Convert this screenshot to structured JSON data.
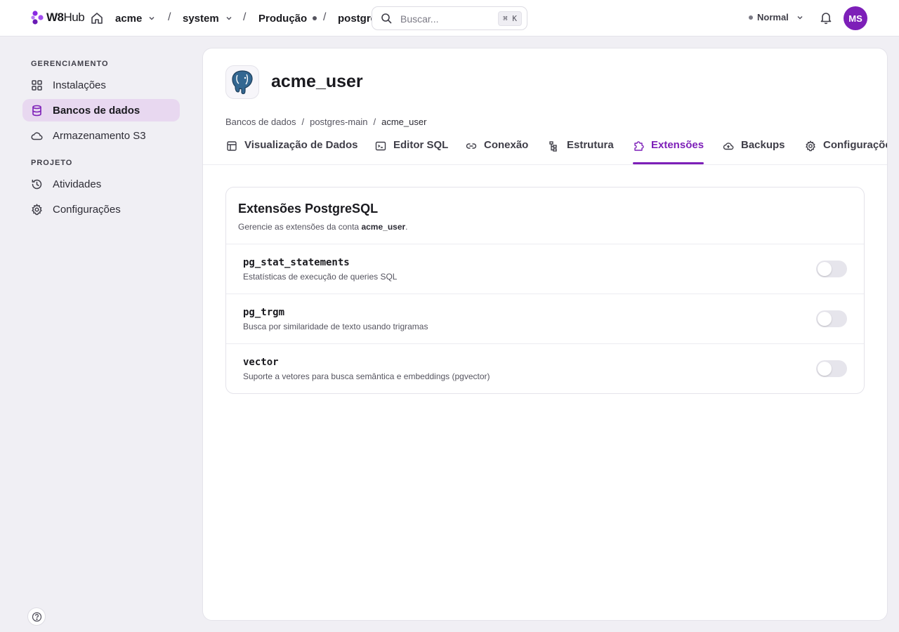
{
  "topbar": {
    "logo_bold": "W8",
    "logo_light": "Hub",
    "crumbs": [
      "acme",
      "system",
      "Produção",
      "postgres"
    ],
    "separator": "/",
    "search_placeholder": "Buscar...",
    "search_shortcut": "⌘ K",
    "mode_label": "Normal",
    "avatar_initials": "MS"
  },
  "sidebar": {
    "section1": "GERENCIAMENTO",
    "items1": [
      {
        "label": "Instalações",
        "icon": "grid-icon"
      },
      {
        "label": "Bancos de dados",
        "icon": "database-icon",
        "active": true
      },
      {
        "label": "Armazenamento S3",
        "icon": "cloud-icon"
      }
    ],
    "section2": "PROJETO",
    "items2": [
      {
        "label": "Atividades",
        "icon": "history-icon"
      },
      {
        "label": "Configurações",
        "icon": "gear-icon"
      }
    ]
  },
  "page": {
    "title": "acme_user",
    "breadcrumb": [
      "Bancos de dados",
      "postgres-main",
      "acme_user"
    ],
    "tabs": [
      {
        "label": "Visualização de Dados",
        "icon": "table-icon"
      },
      {
        "label": "Editor SQL",
        "icon": "terminal-icon"
      },
      {
        "label": "Conexão",
        "icon": "link-icon"
      },
      {
        "label": "Estrutura",
        "icon": "structure-icon"
      },
      {
        "label": "Extensões",
        "icon": "puzzle-icon",
        "active": true
      },
      {
        "label": "Backups",
        "icon": "cloud-upload-icon"
      },
      {
        "label": "Configurações",
        "icon": "gear-icon"
      }
    ]
  },
  "card": {
    "title": "Extensões PostgreSQL",
    "subtitle_prefix": "Gerencie as extensões da conta ",
    "subtitle_account": "acme_user",
    "subtitle_suffix": ".",
    "extensions": [
      {
        "name": "pg_stat_statements",
        "description": "Estatísticas de execução de queries SQL",
        "enabled": false
      },
      {
        "name": "pg_trgm",
        "description": "Busca por similaridade de texto usando trigramas",
        "enabled": false
      },
      {
        "name": "vector",
        "description": "Suporte a vetores para busca semântica e embeddings (pgvector)",
        "enabled": false
      }
    ]
  },
  "colors": {
    "accent": "#7d1fb8",
    "active_nav_bg": "#e8d8f0",
    "app_bg": "#f0eff4"
  }
}
